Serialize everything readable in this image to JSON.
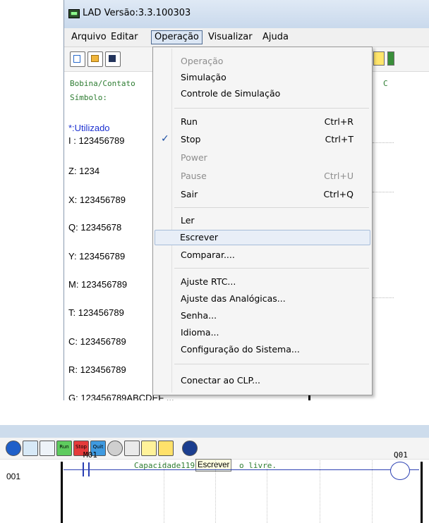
{
  "window": {
    "title": "LAD Versão:3.3.100303",
    "menu": [
      "Arquivo",
      "Editar",
      "Operação",
      "Visualizar",
      "Ajuda"
    ],
    "active_menu": "Operação"
  },
  "panel": {
    "bobina": "Bobina/Contato",
    "simbolo": "Símbolo:",
    "utilizado": "*:Utilizado",
    "right_label": "C",
    "rows": [
      "I : 123456789",
      "Z: 1234",
      "X: 123456789",
      "Q: 12345678",
      "Y: 123456789",
      "M: 123456789",
      "T: 123456789",
      "C: 123456789",
      "R: 123456789",
      "G: 123456789ABCDEF ..."
    ]
  },
  "dropdown": {
    "items": [
      {
        "label": "Operação",
        "shortcut": "",
        "disabled": true
      },
      {
        "label": "Simulação",
        "shortcut": "",
        "disabled": false
      },
      {
        "label": "Controle de Simulação",
        "shortcut": "",
        "disabled": false
      },
      {
        "label": "Run",
        "shortcut": "Ctrl+R",
        "disabled": false
      },
      {
        "label": "Stop",
        "shortcut": "Ctrl+T",
        "disabled": false,
        "checked": true
      },
      {
        "label": "Power",
        "shortcut": "",
        "disabled": true
      },
      {
        "label": "Pause",
        "shortcut": "Ctrl+U",
        "disabled": true
      },
      {
        "label": "Sair",
        "shortcut": "Ctrl+Q",
        "disabled": false
      },
      {
        "label": "Ler",
        "shortcut": "",
        "disabled": false
      },
      {
        "label": "Escrever",
        "shortcut": "",
        "disabled": false,
        "hover": true
      },
      {
        "label": "Comparar....",
        "shortcut": "",
        "disabled": false
      },
      {
        "label": "Ajuste RTC...",
        "shortcut": "",
        "disabled": false
      },
      {
        "label": "Ajuste das Analógicas...",
        "shortcut": "",
        "disabled": false
      },
      {
        "label": "Senha...",
        "shortcut": "",
        "disabled": false
      },
      {
        "label": "Idioma...",
        "shortcut": "",
        "disabled": false
      },
      {
        "label": "Configuração do Sistema...",
        "shortcut": "",
        "disabled": false
      },
      {
        "label": "Conectar ao CLP...",
        "shortcut": "",
        "disabled": false
      }
    ]
  },
  "bottom": {
    "toolbar_labels": {
      "run": "Run",
      "stop": "Stop",
      "quit": "Quit"
    },
    "capacity_left": "Capacidade119",
    "capacity_right": "o livre.",
    "tooltip": "Escrever",
    "rung_number": "001",
    "contact": "M01",
    "coil": "Q01"
  },
  "colors": {
    "accent_blue": "#2a3fb3",
    "mono_green": "#2e7d32",
    "used_blue": "#1a2fd0"
  }
}
